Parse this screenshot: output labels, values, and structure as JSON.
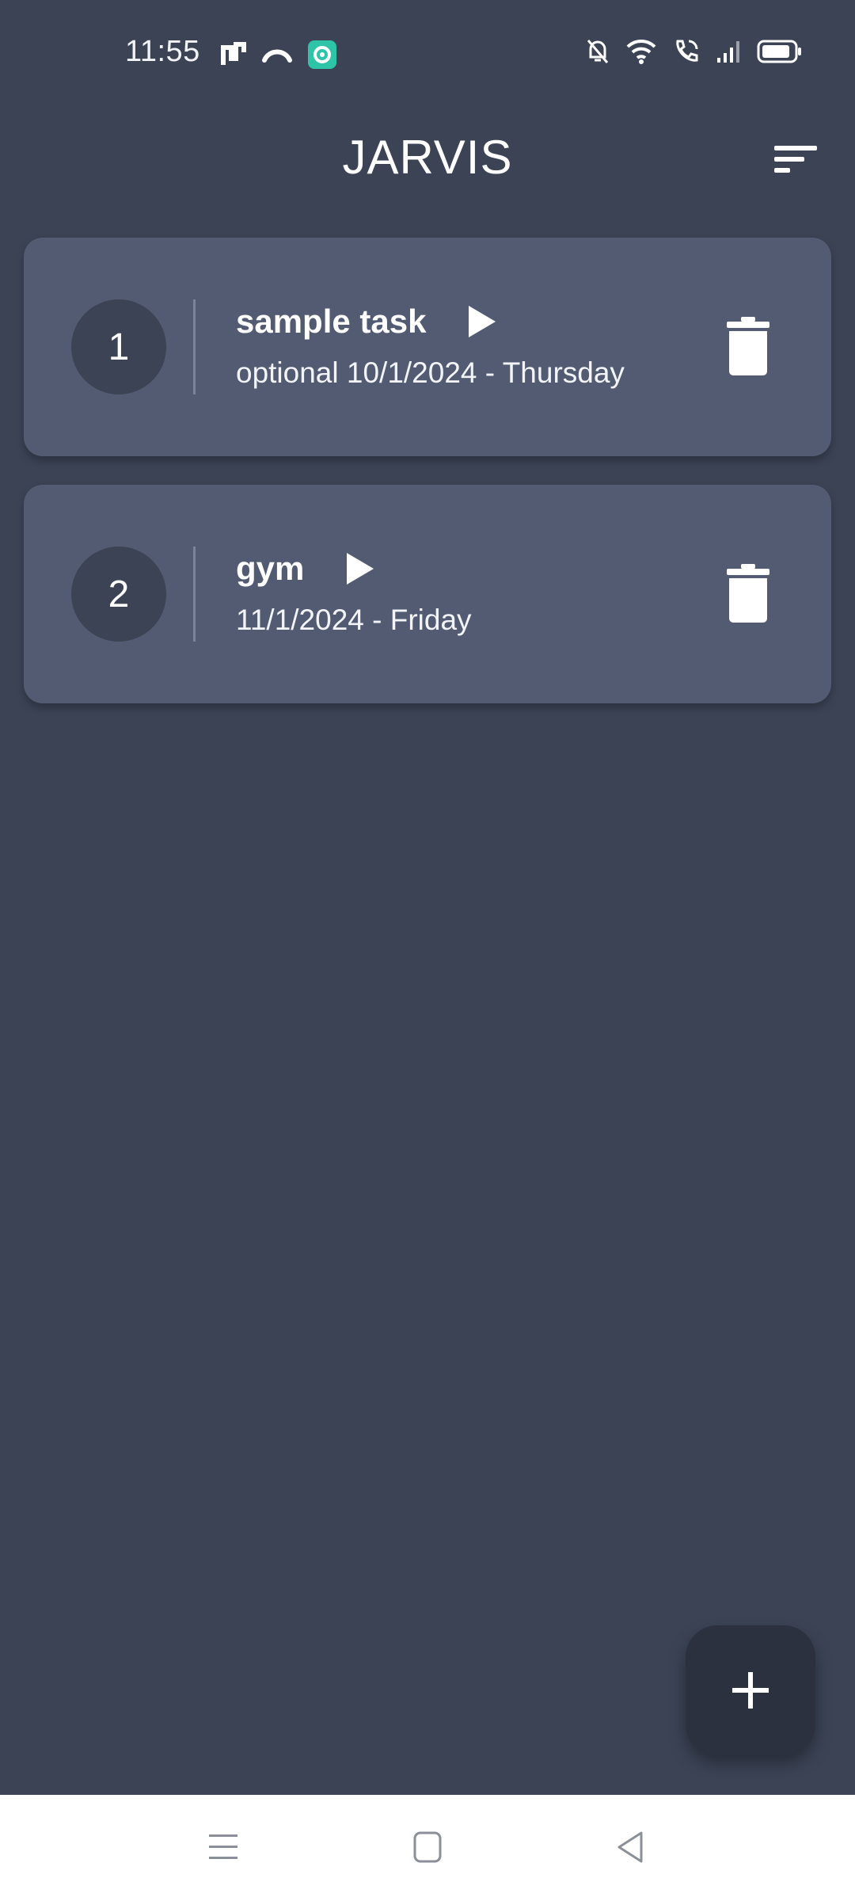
{
  "status_bar": {
    "time": "11:55",
    "left_icons": [
      "nfc-icon",
      "missed-call-icon",
      "app-notification-icon"
    ],
    "right_icons": [
      "bell-off-icon",
      "wifi-icon",
      "wifi-calling-icon",
      "signal-icon",
      "battery-icon"
    ],
    "accent": "#2ec4a8"
  },
  "header": {
    "title": "JARVIS",
    "sort_icon": "sort-icon"
  },
  "tasks": [
    {
      "number": "1",
      "title": "sample task",
      "subtitle": "optional 10/1/2024 - Thursday"
    },
    {
      "number": "2",
      "title": "gym",
      "subtitle": "11/1/2024 - Friday"
    }
  ],
  "fab": {
    "icon": "plus-icon"
  },
  "nav": {
    "icons": [
      "menu-icon",
      "home-icon",
      "back-icon"
    ]
  },
  "colors": {
    "background": "#3b4355",
    "card": "#525b72",
    "number_circle": "#3b4354",
    "fab": "#2c3140"
  }
}
